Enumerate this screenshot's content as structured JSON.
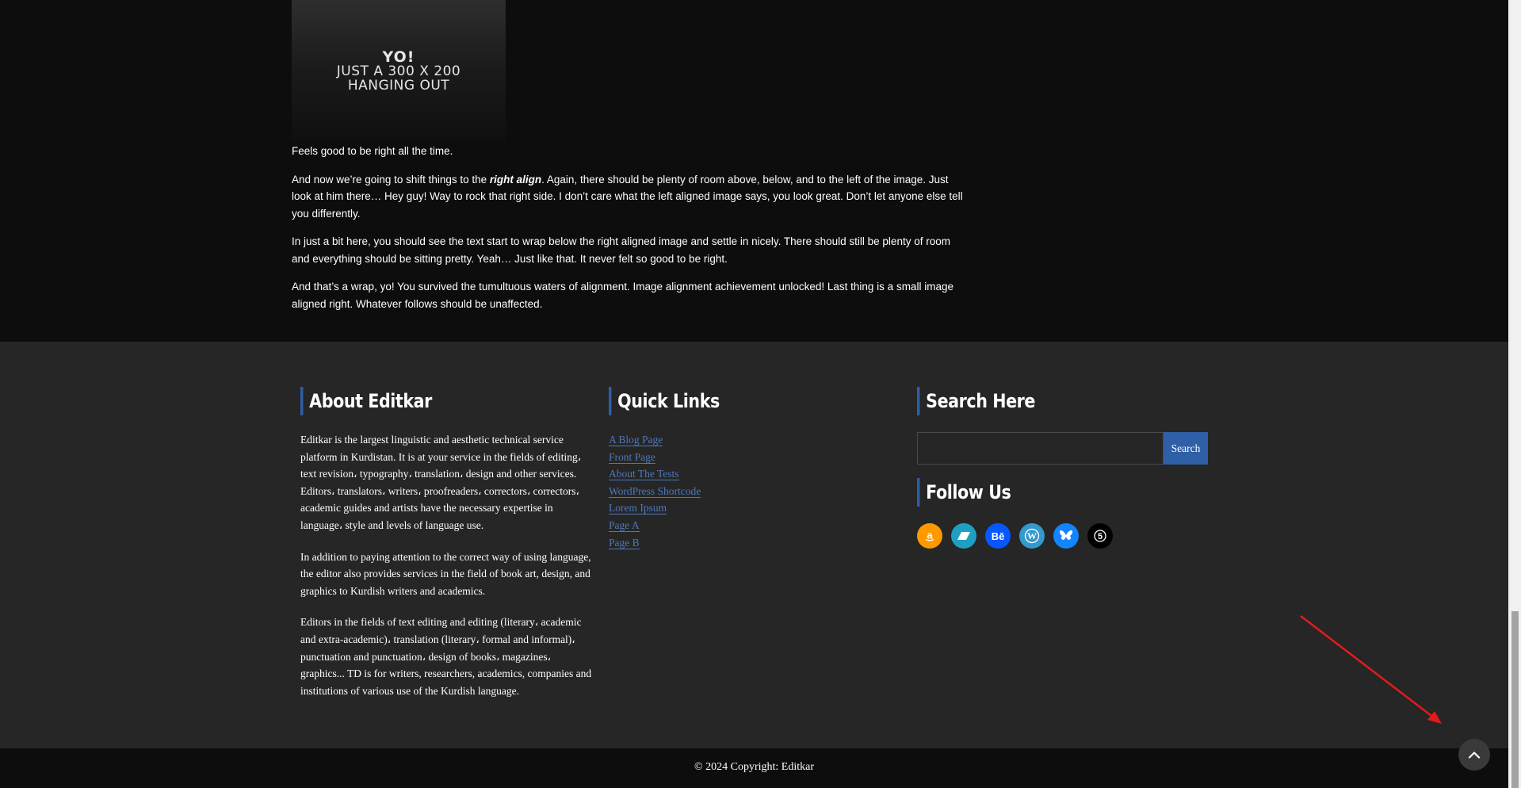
{
  "image": {
    "line1": "YO!",
    "line2": "JUST A 300 X 200",
    "line3": "HANGING OUT"
  },
  "article": {
    "p1": "Feels good to be right all the time.",
    "p2_before": "And now we’re going to shift things to the ",
    "p2_emphasis": "right align",
    "p2_after": ". Again, there should be plenty of room above, below, and to the left of the image. Just look at him there… Hey guy! Way to rock that right side. I don’t care what the left aligned image says, you look great. Don’t let anyone else tell you differently.",
    "p3": "In just a bit here, you should see the text start to wrap below the right aligned image and settle in nicely. There should still be plenty of room and everything should be sitting pretty. Yeah… Just like that. It never felt so good to be right.",
    "p4": "And that’s a wrap, yo! You survived the tumultuous waters of alignment. Image alignment achievement unlocked! Last thing is a small image aligned right. Whatever follows should be unaffected."
  },
  "footer": {
    "about": {
      "title": "About Editkar",
      "p1": "Editkar is the largest linguistic and aesthetic technical service platform in Kurdistan. It is at your service in the fields of editing، text revision، typography، translation، design and other services. Editors، translators، writers، proofreaders، correctors، correctors، academic guides and artists have the necessary expertise in language، style and levels of language use.",
      "p2": "In addition to paying attention to the correct way of using language, the editor also provides services in the field of book art, design, and graphics to Kurdish writers and academics.",
      "p3": "Editors in the fields of text editing and editing (literary، academic and extra-academic)، translation (literary، formal and informal)، punctuation and punctuation، design of books، magazines، graphics... TD is for writers, researchers, academics, companies and institutions of various use of the Kurdish language."
    },
    "quick_links": {
      "title": "Quick Links",
      "items": [
        "A Blog Page",
        "Front Page",
        "About The Tests",
        "WordPress Shortcode",
        "Lorem Ipsum",
        "Page A",
        "Page B"
      ]
    },
    "search": {
      "title": "Search Here",
      "button": "Search",
      "value": ""
    },
    "follow": {
      "title": "Follow Us",
      "icons": [
        "amazon-icon",
        "bandcamp-icon",
        "behance-icon",
        "wordpress-icon",
        "bluesky-icon",
        "500px-icon"
      ],
      "colors": [
        "#f90",
        "#1ea0c3",
        "#0757fe",
        "#3499cd",
        "#1185fe",
        "#000000"
      ]
    }
  },
  "bottom": {
    "copyright": "© 2024 Copyright: Editkar"
  },
  "colors": {
    "accent": "#2f5fa6",
    "link": "#4e78b8",
    "annotation": "#e31b1b"
  }
}
